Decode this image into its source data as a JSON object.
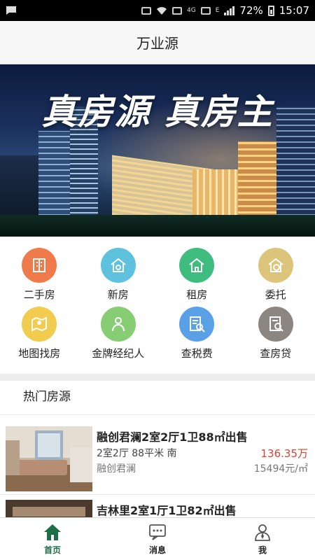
{
  "status_bar": {
    "network_label": "4G",
    "network_type": "E",
    "battery_percent": "72%",
    "time": "15:07"
  },
  "header": {
    "title": "万业源"
  },
  "banner": {
    "slogan": "真房源 真房主"
  },
  "menu": [
    {
      "label": "二手房",
      "icon": "secondhand-house-icon",
      "color": "#f07b4a"
    },
    {
      "label": "新房",
      "icon": "new-house-icon",
      "color": "#5ec2de"
    },
    {
      "label": "租房",
      "icon": "rent-house-icon",
      "color": "#3fbd7e"
    },
    {
      "label": "委托",
      "icon": "entrust-icon",
      "color": "#dcc57a"
    },
    {
      "label": "地图找房",
      "icon": "map-search-icon",
      "color": "#f2cc4e"
    },
    {
      "label": "金牌经纪人",
      "icon": "agent-icon",
      "color": "#87cd73"
    },
    {
      "label": "查税费",
      "icon": "tax-check-icon",
      "color": "#5aa0e6"
    },
    {
      "label": "查房贷",
      "icon": "mortgage-check-icon",
      "color": "#8c8682"
    }
  ],
  "section": {
    "title": "热门房源"
  },
  "listings": [
    {
      "title": "融创君澜2室2厅1卫88㎡出售",
      "spec": "2室2厅 88平米 南",
      "price": "136.35万",
      "community": "融创君澜",
      "unit_price": "15494元/㎡"
    },
    {
      "title": "吉林里2室1厅1卫82㎡出售",
      "spec": "",
      "price": "",
      "community": "",
      "unit_price": ""
    }
  ],
  "bottom_nav": [
    {
      "label": "首页",
      "icon": "home-icon",
      "active": true
    },
    {
      "label": "消息",
      "icon": "message-icon",
      "active": false
    },
    {
      "label": "我",
      "icon": "profile-icon",
      "active": false
    }
  ],
  "colors": {
    "accent_green": "#1e6f47",
    "price_red": "#d24434"
  }
}
